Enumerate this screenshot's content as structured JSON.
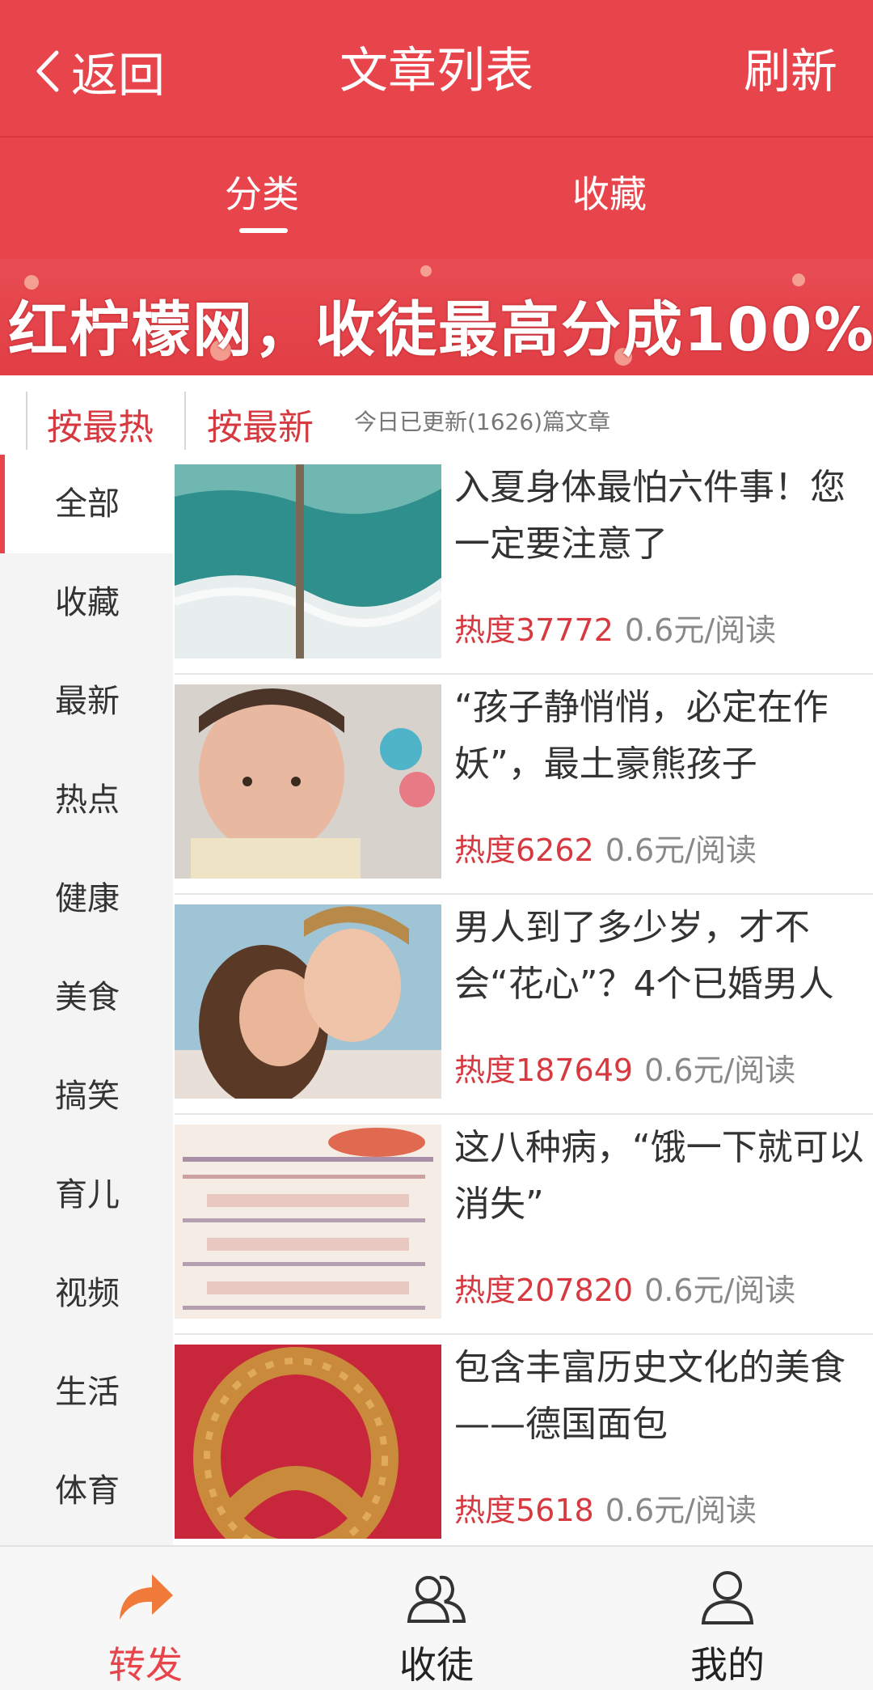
{
  "header": {
    "back_label": "返回",
    "title": "文章列表",
    "refresh_label": "刷新"
  },
  "tabs": [
    {
      "label": "分类",
      "active": true
    },
    {
      "label": "收藏",
      "active": false
    }
  ],
  "banner": {
    "text": "红柠檬网，收徒最高分成100%"
  },
  "filters": {
    "hot_label": "按最热",
    "new_label": "按最新",
    "update_info": "今日已更新(1626)篇文章"
  },
  "sidebar": {
    "items": [
      {
        "label": "全部",
        "active": true
      },
      {
        "label": "收藏"
      },
      {
        "label": "最新"
      },
      {
        "label": "热点"
      },
      {
        "label": "健康"
      },
      {
        "label": "美食"
      },
      {
        "label": "搞笑"
      },
      {
        "label": "育儿"
      },
      {
        "label": "视频"
      },
      {
        "label": "生活"
      },
      {
        "label": "体育"
      }
    ]
  },
  "articles": [
    {
      "title": "入夏身体最怕六件事！您一定要注意了",
      "hot": "热度37772",
      "price": "0.6元/阅读"
    },
    {
      "title": "“孩子静悄悄，必定在作妖”，最土豪熊孩子",
      "hot": "热度6262",
      "price": "0.6元/阅读"
    },
    {
      "title": "男人到了多少岁，才不会“花心”？4个已婚男人",
      "hot": "热度187649",
      "price": "0.6元/阅读"
    },
    {
      "title": "这八种病，“饿一下就可以消失”",
      "hot": "热度207820",
      "price": "0.6元/阅读"
    },
    {
      "title": "包含丰富历史文化的美食——德国面包",
      "hot": "热度5618",
      "price": "0.6元/阅读"
    }
  ],
  "bottom_nav": [
    {
      "label": "转发",
      "icon": "share-arrow-icon",
      "active": true
    },
    {
      "label": "收徒",
      "icon": "users-icon"
    },
    {
      "label": "我的",
      "icon": "user-icon"
    }
  ],
  "colors": {
    "primary": "#e8444b",
    "hot_text": "#d6393f",
    "muted": "#888888",
    "sidebar_bg": "#f4f4f4"
  }
}
